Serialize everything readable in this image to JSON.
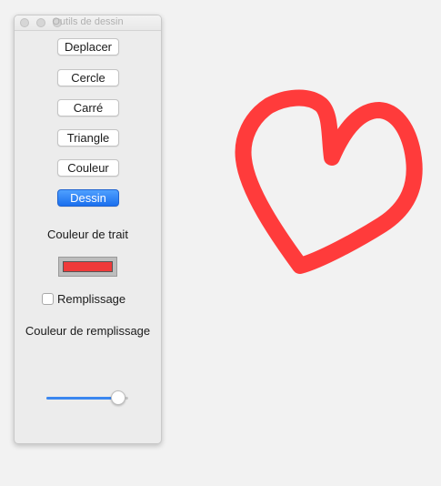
{
  "window": {
    "title": "Outils de dessin"
  },
  "tools": [
    {
      "label": "Deplacer",
      "selected": false
    },
    {
      "label": "Cercle",
      "selected": false
    },
    {
      "label": "Carré",
      "selected": false
    },
    {
      "label": "Triangle",
      "selected": false
    },
    {
      "label": "Couleur",
      "selected": false
    },
    {
      "label": "Dessin",
      "selected": true
    }
  ],
  "stroke": {
    "label": "Couleur de trait",
    "color": "#ef3a3a"
  },
  "fill": {
    "checkbox_label": "Remplissage",
    "checked": false,
    "color_label": "Couleur de remplissage"
  },
  "slider": {
    "value": 0.88
  },
  "drawing": {
    "shape": "heart",
    "stroke_color": "#ff3b3b"
  },
  "colors": {
    "background": "#f2f2f2",
    "accent": "#1a6fee"
  }
}
